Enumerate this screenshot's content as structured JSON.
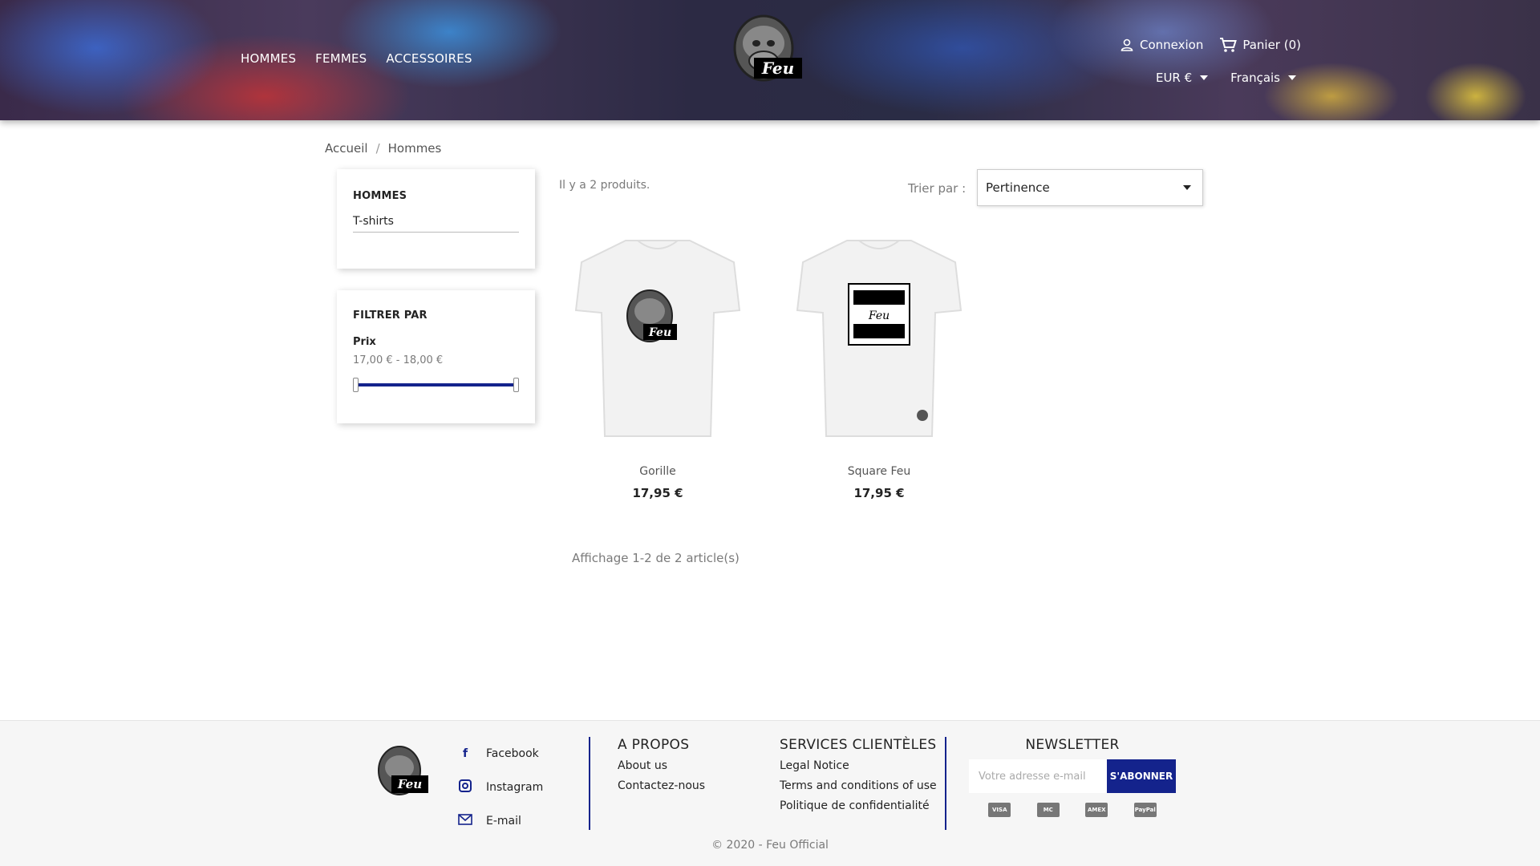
{
  "header": {
    "nav": [
      "HOMMES",
      "FEMMES",
      "ACCESSOIRES"
    ],
    "logo_text": "Feu",
    "login_label": "Connexion",
    "cart_label": "Panier (0)",
    "currency": "EUR €",
    "language": "Français"
  },
  "breadcrumb": [
    "Accueil",
    "Hommes"
  ],
  "categories": {
    "title": "HOMMES",
    "items": [
      "T-shirts"
    ]
  },
  "filter": {
    "title": "FILTRER PAR",
    "label": "Prix",
    "range": "17,00 € - 18,00 €",
    "accent": "#14238c"
  },
  "listing": {
    "count_text": "Il y a 2 produits.",
    "sort_label": "Trier par :",
    "sort_value": "Pertinence",
    "pagination": "Affichage 1-2 de 2 article(s)"
  },
  "products": [
    {
      "name": "Gorille",
      "price": "17,95 €"
    },
    {
      "name": "Square Feu",
      "price": "17,95 €"
    }
  ],
  "footer": {
    "social": [
      {
        "icon": "facebook-icon",
        "label": "Facebook"
      },
      {
        "icon": "instagram-icon",
        "label": "Instagram"
      },
      {
        "icon": "email-icon",
        "label": "E-mail"
      }
    ],
    "about": {
      "title": "A PROPOS",
      "links": [
        "About us",
        "Contactez-nous"
      ]
    },
    "services": {
      "title": "SERVICES CLIENTÈLES",
      "links": [
        "Legal Notice",
        "Terms and conditions of use",
        "Politique de confidentialité"
      ]
    },
    "newsletter": {
      "title": "NEWSLETTER",
      "placeholder": "Votre adresse e-mail",
      "button": "S'ABONNER",
      "payments": [
        "VISA",
        "MC",
        "AMEX",
        "PayPal"
      ]
    },
    "copyright": "© 2020 - Feu Official"
  }
}
